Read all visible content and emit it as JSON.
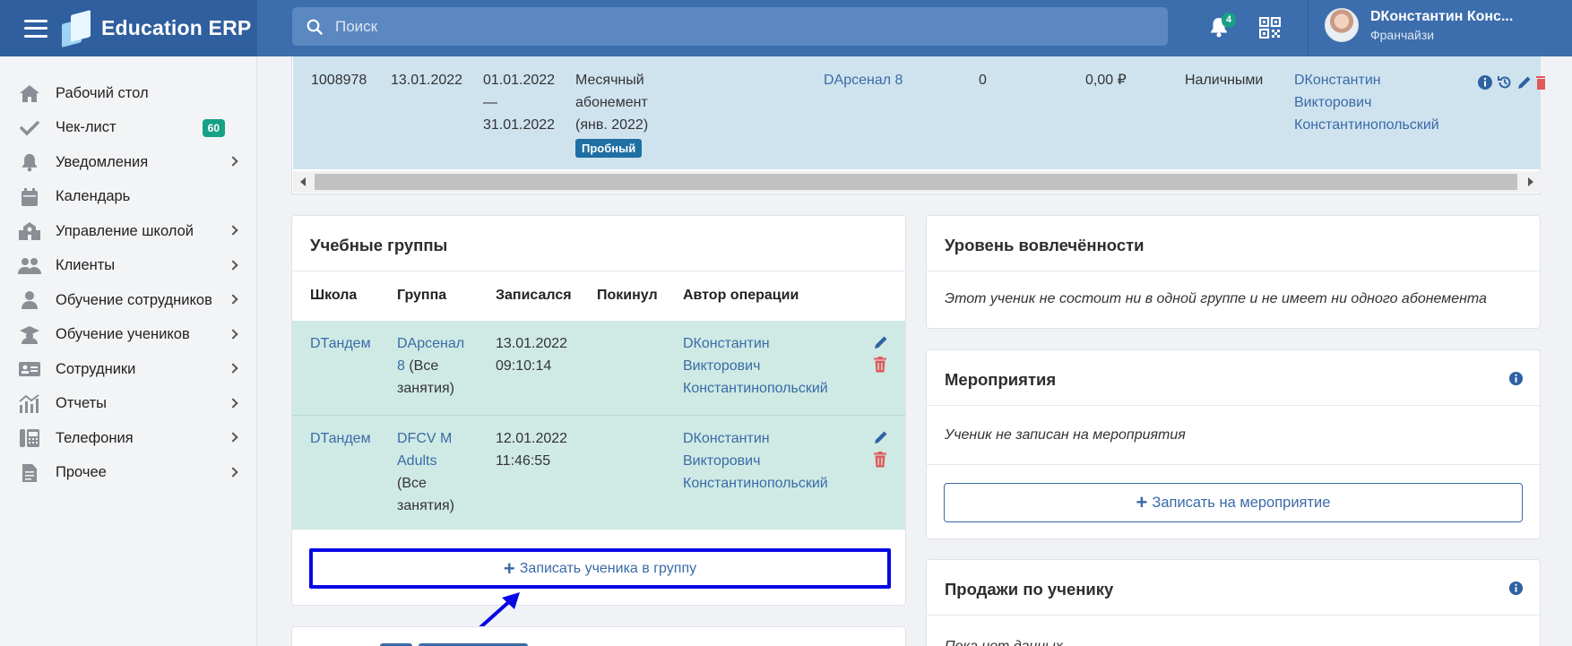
{
  "app": {
    "name": "Education ERP"
  },
  "search": {
    "placeholder": "Поиск"
  },
  "header": {
    "notifications_count": "4",
    "user_name": "DКонстантин Конс...",
    "user_role": "Франчайзи"
  },
  "sidebar": {
    "items": [
      {
        "label": "Рабочий стол",
        "icon": "home-icon"
      },
      {
        "label": "Чек-лист",
        "icon": "check-icon",
        "badge": "60"
      },
      {
        "label": "Уведомления",
        "icon": "bell-icon"
      },
      {
        "label": "Календарь",
        "icon": "calendar-icon"
      },
      {
        "label": "Управление школой",
        "icon": "school-icon"
      },
      {
        "label": "Клиенты",
        "icon": "users-icon"
      },
      {
        "label": "Обучение сотрудников",
        "icon": "staff-training-icon"
      },
      {
        "label": "Обучение учеников",
        "icon": "graduation-cap-icon"
      },
      {
        "label": "Сотрудники",
        "icon": "id-card-icon"
      },
      {
        "label": "Отчеты",
        "icon": "chart-icon"
      },
      {
        "label": "Телефония",
        "icon": "phone-icon"
      },
      {
        "label": "Прочее",
        "icon": "file-icon"
      }
    ]
  },
  "subscription_row": {
    "id": "1008978",
    "date": "13.01.2022",
    "period_start": "01.01.2022",
    "period_dash": "—",
    "period_end": "31.01.2022",
    "name_line1": "Месячный",
    "name_line2": "абонемент",
    "name_line3": "(янв. 2022)",
    "tag": "Пробный",
    "group": "DАрсенал 8",
    "count": "0",
    "amount": "0,00 ₽",
    "payment": "Наличными",
    "author_line1": "DКонстантин",
    "author_line2": "Викторович",
    "author_line3": "Константинопольский"
  },
  "groups": {
    "title": "Учебные группы",
    "headers": [
      "Школа",
      "Группа",
      "Записался",
      "Покинул",
      "Автор операции"
    ],
    "rows": [
      {
        "school": "DТандем",
        "group_line1": "DАрсенал",
        "group_line2": "8",
        "group_suffix": " (Все",
        "group_line3": "занятия)",
        "joined_date": "13.01.2022",
        "joined_time": "09:10:14",
        "author_line1": "DКонстантин",
        "author_line2": "Викторович",
        "author_line3": "Константинопольский"
      },
      {
        "school": "DТандем",
        "group_line1": "DFCV M",
        "group_line2": "Adults",
        "group_suffix": "",
        "group_line3": "(Все",
        "group_line4": "занятия)",
        "joined_date": "12.01.2022",
        "joined_time": "11:46:55",
        "author_line1": "DКонстантин",
        "author_line2": "Викторович",
        "author_line3": "Константинопольский"
      }
    ],
    "add_button": "Записать ученика в группу"
  },
  "engagement": {
    "title": "Уровень вовлечённости",
    "text": "Этот ученик не состоит ни в одной группе и не имеет ни одного абонемента"
  },
  "events": {
    "title": "Мероприятия",
    "text": "Ученик не записан на мероприятия",
    "button": "Записать на мероприятие"
  },
  "sales": {
    "title": "Продажи по ученику",
    "text": "Пока нет данных"
  },
  "colors": {
    "header": "#3c6ead",
    "brand_bg": "#2f5f9e",
    "link": "#3a6ba5",
    "row_highlight": "#cfe3ef",
    "group_row": "#cfeae5",
    "badge": "#17a084",
    "delete": "#e05a5a",
    "annotation": "#0707e6"
  }
}
